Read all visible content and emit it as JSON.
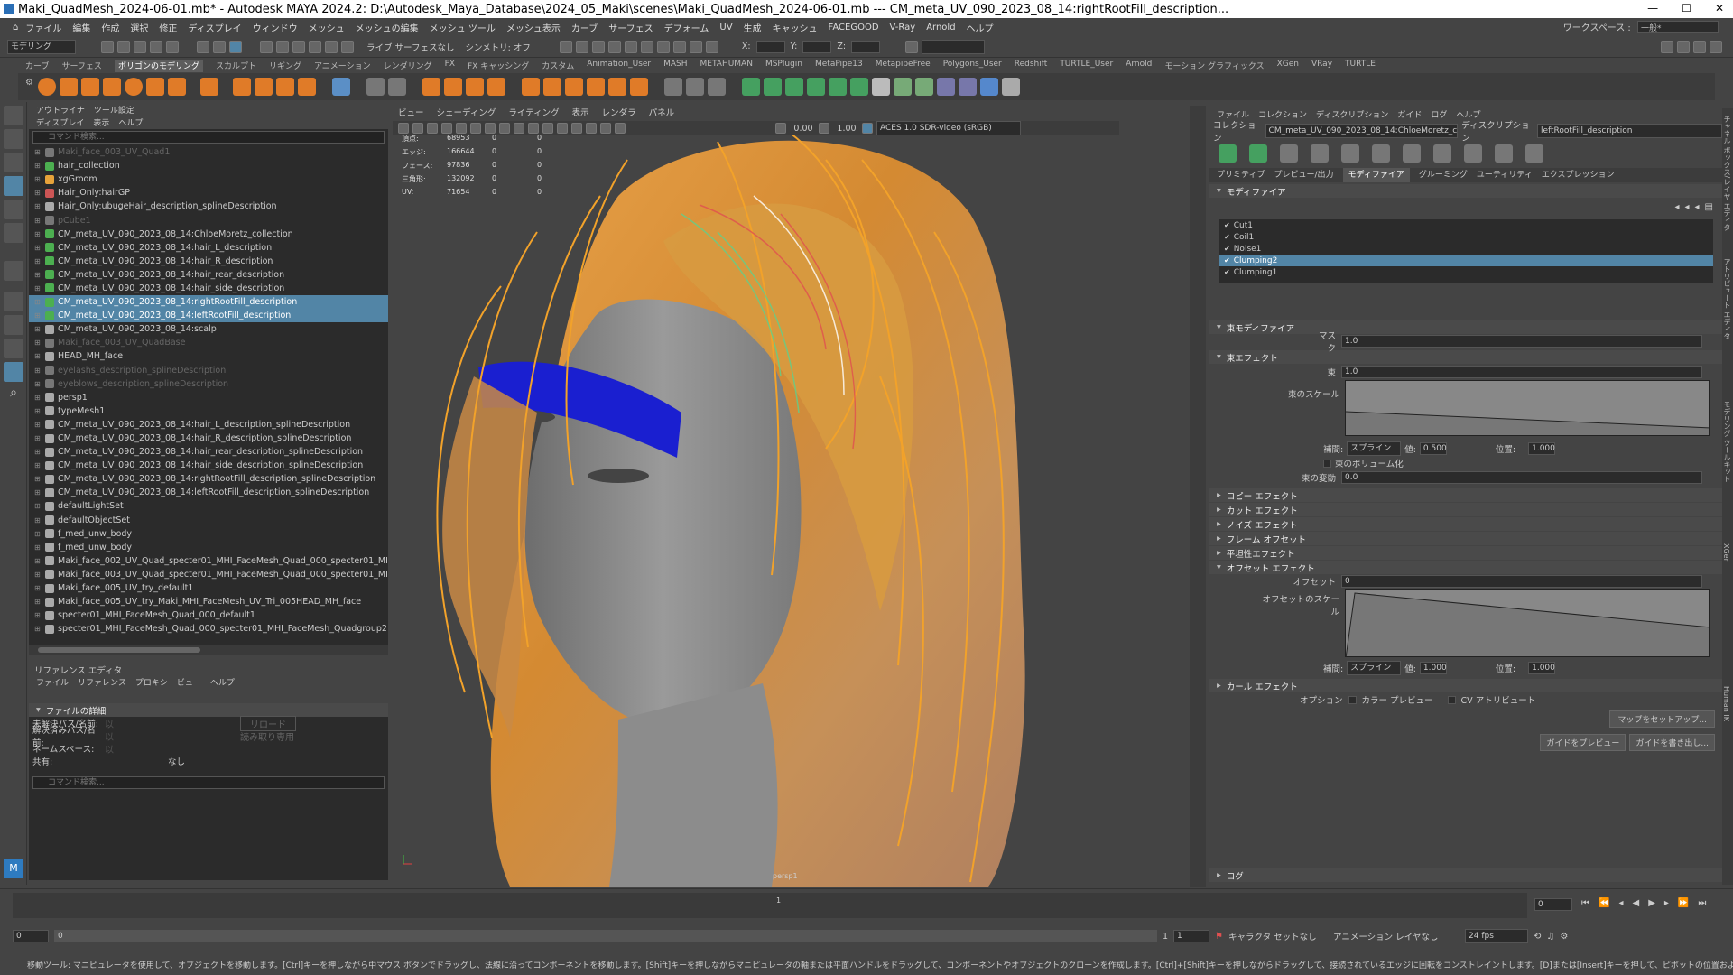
{
  "app": {
    "title": "Maki_QuadMesh_2024-06-01.mb* - Autodesk MAYA 2024.2: D:\\Autodesk_Maya_Database\\2024_05_Maki\\scenes\\Maki_QuadMesh_2024-06-01.mb   ---   CM_meta_UV_090_2023_08_14:rightRootFill_description...",
    "workspace_label": "ワークスペース :",
    "workspace_value": "一般*",
    "menu": [
      "ファイル",
      "編集",
      "作成",
      "選択",
      "修正",
      "ディスプレイ",
      "ウィンドウ",
      "メッシュ",
      "メッシュの編集",
      "メッシュ ツール",
      "メッシュ表示",
      "カーブ",
      "サーフェス",
      "デフォーム",
      "UV",
      "生成",
      "キャッシュ",
      "FACEGOOD",
      "V-Ray",
      "Arnold",
      "ヘルプ"
    ]
  },
  "statusline": {
    "mode": "モデリング",
    "live_surface": "ライブ サーフェスなし",
    "symmetry": "シンメトリ: オフ",
    "x_label": "X:",
    "y_label": "Y:",
    "z_label": "Z:"
  },
  "shelf_tabs": [
    "カーブ",
    "サーフェス",
    "ポリゴンのモデリング",
    "スカルプト",
    "リギング",
    "アニメーション",
    "レンダリング",
    "FX",
    "FX キャッシング",
    "カスタム",
    "Animation_User",
    "MASH",
    "METAHUMAN",
    "MSPlugin",
    "MetaPipe13",
    "MetapipeFree",
    "Polygons_User",
    "Redshift",
    "TURTLE_User",
    "Arnold",
    "モーション グラフィックス",
    "XGen",
    "VRay",
    "TURTLE"
  ],
  "outliner": {
    "tabs": [
      "アウトライナ",
      "ツール設定"
    ],
    "menu": [
      "ディスプレイ",
      "表示",
      "ヘルプ"
    ],
    "search_placeholder": "コマンド検索...",
    "items": [
      {
        "label": "Maki_face_003_UV_Quad1",
        "state": "dim",
        "color": "#777"
      },
      {
        "label": "hair_collection",
        "state": "",
        "color": "#4caf50"
      },
      {
        "label": "xgGroom",
        "state": "",
        "color": "#e8a33a"
      },
      {
        "label": "Hair_Only:hairGP",
        "state": "",
        "color": "#cc5555"
      },
      {
        "label": "Hair_Only:ubugeHair_description_splineDescription",
        "state": "",
        "color": "#aaaaaa"
      },
      {
        "label": "pCube1",
        "state": "dim",
        "color": "#777"
      },
      {
        "label": "CM_meta_UV_090_2023_08_14:ChloeMoretz_collection",
        "state": "",
        "color": "#4caf50"
      },
      {
        "label": "CM_meta_UV_090_2023_08_14:hair_L_description",
        "state": "",
        "color": "#4caf50"
      },
      {
        "label": "CM_meta_UV_090_2023_08_14:hair_R_description",
        "state": "",
        "color": "#4caf50"
      },
      {
        "label": "CM_meta_UV_090_2023_08_14:hair_rear_description",
        "state": "",
        "color": "#4caf50"
      },
      {
        "label": "CM_meta_UV_090_2023_08_14:hair_side_description",
        "state": "",
        "color": "#4caf50"
      },
      {
        "label": "CM_meta_UV_090_2023_08_14:rightRootFill_description",
        "state": "sel",
        "color": "#4caf50"
      },
      {
        "label": "CM_meta_UV_090_2023_08_14:leftRootFill_description",
        "state": "sel",
        "color": "#4caf50"
      },
      {
        "label": "CM_meta_UV_090_2023_08_14:scalp",
        "state": "",
        "color": "#aaaaaa"
      },
      {
        "label": "Maki_face_003_UV_QuadBase",
        "state": "dim",
        "color": "#777"
      },
      {
        "label": "HEAD_MH_face",
        "state": "",
        "color": "#aaaaaa"
      },
      {
        "label": "eyelashs_description_splineDescription",
        "state": "dim",
        "color": "#777"
      },
      {
        "label": "eyeblows_description_splineDescription",
        "state": "dim",
        "color": "#777"
      },
      {
        "label": "persp1",
        "state": "",
        "color": "#aaaaaa"
      },
      {
        "label": "typeMesh1",
        "state": "",
        "color": "#aaaaaa"
      },
      {
        "label": "CM_meta_UV_090_2023_08_14:hair_L_description_splineDescription",
        "state": "",
        "color": "#aaaaaa"
      },
      {
        "label": "CM_meta_UV_090_2023_08_14:hair_R_description_splineDescription",
        "state": "",
        "color": "#aaaaaa"
      },
      {
        "label": "CM_meta_UV_090_2023_08_14:hair_rear_description_splineDescription",
        "state": "",
        "color": "#aaaaaa"
      },
      {
        "label": "CM_meta_UV_090_2023_08_14:hair_side_description_splineDescription",
        "state": "",
        "color": "#aaaaaa"
      },
      {
        "label": "CM_meta_UV_090_2023_08_14:rightRootFill_description_splineDescription",
        "state": "",
        "color": "#aaaaaa"
      },
      {
        "label": "CM_meta_UV_090_2023_08_14:leftRootFill_description_splineDescription",
        "state": "",
        "color": "#aaaaaa"
      },
      {
        "label": "defaultLightSet",
        "state": "",
        "color": "#aaaaaa"
      },
      {
        "label": "defaultObjectSet",
        "state": "",
        "color": "#aaaaaa"
      },
      {
        "label": "f_med_unw_body",
        "state": "",
        "color": "#aaaaaa"
      },
      {
        "label": "f_med_unw_body",
        "state": "",
        "color": "#aaaaaa"
      },
      {
        "label": "Maki_face_002_UV_Quad_specter01_MHI_FaceMesh_Quad_000_specter01_MI",
        "state": "",
        "color": "#aaaaaa"
      },
      {
        "label": "Maki_face_003_UV_Quad_specter01_MHI_FaceMesh_Quad_000_specter01_MI",
        "state": "",
        "color": "#aaaaaa"
      },
      {
        "label": "Maki_face_005_UV_try_default1",
        "state": "",
        "color": "#aaaaaa"
      },
      {
        "label": "Maki_face_005_UV_try_Maki_MHI_FaceMesh_UV_Tri_005HEAD_MH_face",
        "state": "",
        "color": "#aaaaaa"
      },
      {
        "label": "specter01_MHI_FaceMesh_Quad_000_default1",
        "state": "",
        "color": "#aaaaaa"
      },
      {
        "label": "specter01_MHI_FaceMesh_Quad_000_specter01_MHI_FaceMesh_Quadgroup2",
        "state": "",
        "color": "#aaaaaa"
      }
    ]
  },
  "reference_editor": {
    "title": "リファレンス エディタ",
    "menu": [
      "ファイル",
      "リファレンス",
      "プロキシ",
      "ビュー",
      "ヘルプ"
    ],
    "section": "ファイルの詳細",
    "unresolved_label": "未解決パス/名前:",
    "resolved_label": "解決済みパス/名前:",
    "namespace_label": "ネームスペース:",
    "shared_label": "共有:",
    "shared_value": "なし",
    "placeholder": "以",
    "reload": "リロード",
    "readonly": "読み取り専用",
    "search_placeholder": "コマンド検索..."
  },
  "viewport": {
    "menu": [
      "ビュー",
      "シェーディング",
      "ライティング",
      "表示",
      "レンダラ",
      "パネル"
    ],
    "exposure": "0.00",
    "gamma": "1.00",
    "colorspace": "ACES 1.0 SDR-video (sRGB)",
    "camera": "persp1",
    "hud": [
      {
        "label": "頂点:",
        "a": "68953",
        "b": "0",
        "c": "0"
      },
      {
        "label": "エッジ:",
        "a": "166644",
        "b": "0",
        "c": "0"
      },
      {
        "label": "フェース:",
        "a": "97836",
        "b": "0",
        "c": "0"
      },
      {
        "label": "三角形:",
        "a": "132092",
        "b": "0",
        "c": "0"
      },
      {
        "label": "UV:",
        "a": "71654",
        "b": "0",
        "c": "0"
      }
    ]
  },
  "xgen": {
    "menu": [
      "ファイル",
      "コレクション",
      "ディスクリプション",
      "ガイド",
      "ログ",
      "ヘルプ"
    ],
    "collection_label": "コレクション",
    "collection_value": "CM_meta_UV_090_2023_08_14:ChloeMoretz_c",
    "description_label": "ディスクリプション",
    "description_value": "leftRootFill_description",
    "tabs": [
      "プリミティブ",
      "プレビュー/出力",
      "モディファイア",
      "グルーミング",
      "ユーティリティ",
      "エクスプレッション"
    ],
    "modifier_header": "モディファイア",
    "modifiers": [
      {
        "label": "Cut1",
        "selected": false
      },
      {
        "label": "Coil1",
        "selected": false
      },
      {
        "label": "Noise1",
        "selected": false
      },
      {
        "label": "Clumping2",
        "selected": true
      },
      {
        "label": "Clumping1",
        "selected": false
      }
    ],
    "clump_modifier": "束モディファイア",
    "mask_label": "マスク",
    "mask_value": "1.0",
    "clump_effect": "束エフェクト",
    "clump_label": "束",
    "clump_value": "1.0",
    "clump_scale_label": "束のスケール",
    "interp_label": "補間:",
    "interp_value": "スプライン",
    "value_label": "値:",
    "value_1": "0.500",
    "pos_label": "位置:",
    "pos_1": "1.000",
    "volume_label": "束のボリューム化",
    "variation_label": "束の変動",
    "variation_value": "0.0",
    "sections": [
      "コピー エフェクト",
      "カット エフェクト",
      "ノイズ エフェクト",
      "フレーム オフセット",
      "平坦性エフェクト"
    ],
    "offset_effect": "オフセット エフェクト",
    "offset_label": "オフセット",
    "offset_value": "0",
    "offset_scale_label": "オフセットのスケール",
    "value_2": "1.000",
    "pos_2": "1.000",
    "curl_effect": "カール エフェクト",
    "option_label": "オプション",
    "color_preview": "カラー プレビュー",
    "cv_attr": "CV アトリビュート",
    "setup_maps": "マップをセットアップ...",
    "preview_guides": "ガイドをプレビュー",
    "write_guides": "ガイドを書き出し...",
    "log": "ログ"
  },
  "side_tabs": [
    "チャネル ボックス/レイヤ エディタ",
    "アトリビュート エディタ",
    "モデリング ツールキット",
    "XGen",
    "Human IK"
  ],
  "time": {
    "start_left": "0",
    "start_left2": "0",
    "frame_one": "1",
    "current_frame": "0",
    "range_start": "0",
    "range_start2": "0",
    "range_end": "1",
    "range_end2": "1",
    "character_set": "キャラクタ セットなし",
    "anim_layer": "アニメーション レイヤなし",
    "fps": "24 fps"
  },
  "help_line": "移動ツール: マニピュレータを使用して、オブジェクトを移動します。[Ctrl]キーを押しながら中マウス ボタンでドラッグし、法線に沿ってコンポーネントを移動します。[Shift]キーを押しながらマニピュレータの軸または平面ハンドルをドラッグして、コンポーネントやオブジェクトのクローンを作成します。[Ctrl]+[Shift]キーを押しながらドラッグして、接続されているエッジに回転をコンストレイントします。[D]または[Insert]キーを押して、ピボットの位置および軸の方向を変更します。",
  "colors": {
    "selection": "#5285a6",
    "panel_dark": "#2b2b2b",
    "panel": "#444444",
    "hair_orange": "#f2a22a",
    "headband_blue": "#1a1fd0",
    "skin_gray": "#8a8a8a"
  }
}
